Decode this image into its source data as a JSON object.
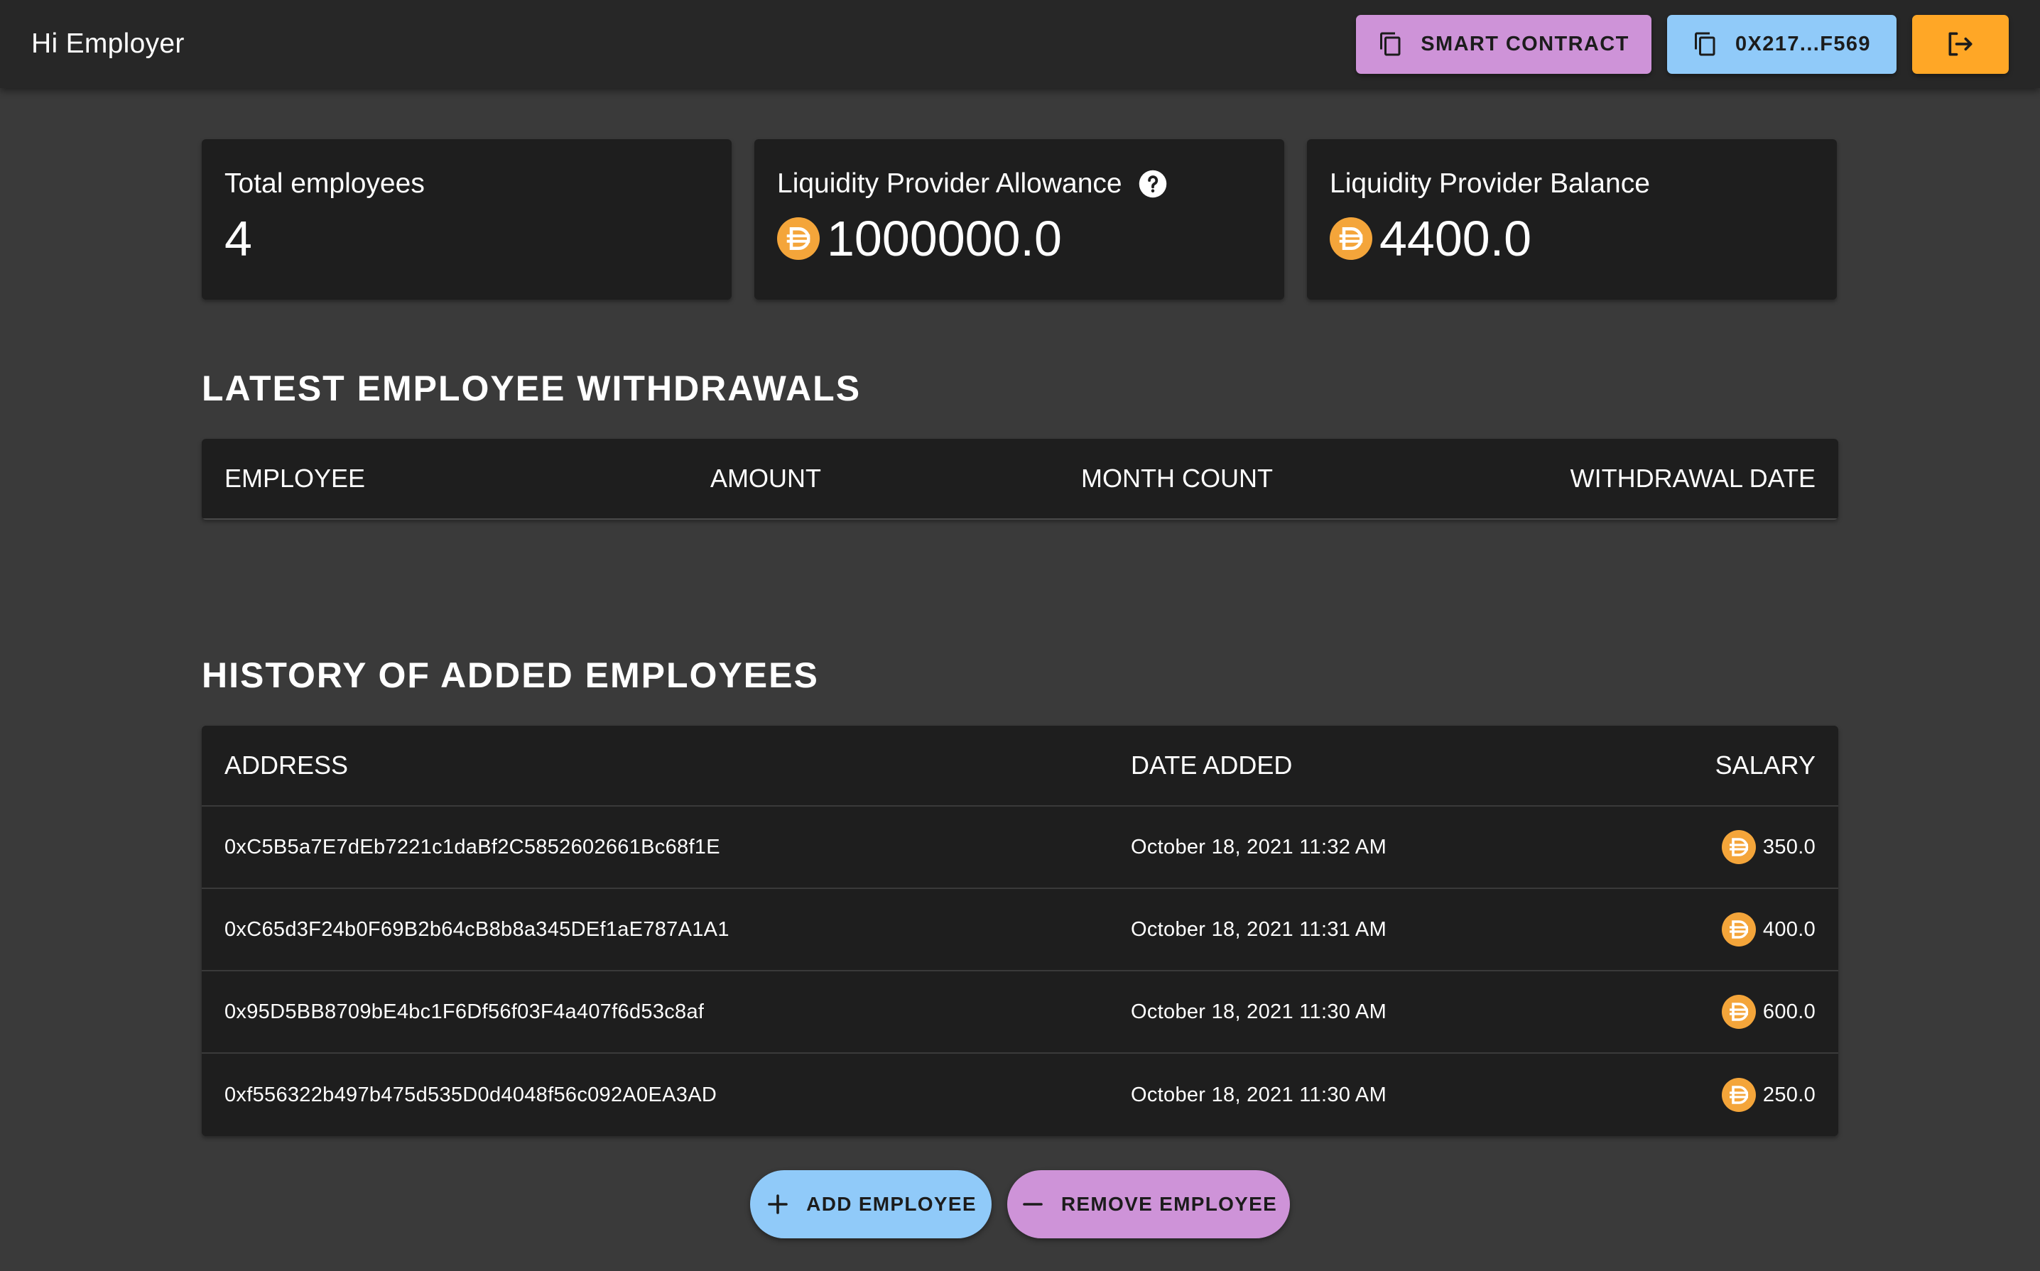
{
  "header": {
    "greeting": "Hi Employer",
    "smart_contract_label": "SMART CONTRACT",
    "wallet_label": "0X217...F569",
    "logout_icon": "logout-icon"
  },
  "stats": {
    "total_employees_label": "Total employees",
    "total_employees_value": "4",
    "allowance_label": "Liquidity Provider Allowance",
    "allowance_value": "1000000.0",
    "balance_label": "Liquidity Provider Balance",
    "balance_value": "4400.0"
  },
  "withdrawals": {
    "title": "LATEST EMPLOYEE WITHDRAWALS",
    "columns": [
      "EMPLOYEE",
      "AMOUNT",
      "MONTH COUNT",
      "WITHDRAWAL DATE"
    ],
    "rows": []
  },
  "history": {
    "title": "HISTORY OF ADDED EMPLOYEES",
    "columns": [
      "ADDRESS",
      "DATE ADDED",
      "SALARY"
    ],
    "rows": [
      {
        "address": "0xC5B5a7E7dEb7221c1daBf2C5852602661Bc68f1E",
        "date": "October 18, 2021 11:32 AM",
        "salary": "350.0"
      },
      {
        "address": "0xC65d3F24b0F69B2b64cB8b8a345DEf1aE787A1A1",
        "date": "October 18, 2021 11:31 AM",
        "salary": "400.0"
      },
      {
        "address": "0x95D5BB8709bE4bc1F6Df56f03F4a407f6d53c8af",
        "date": "October 18, 2021 11:30 AM",
        "salary": "600.0"
      },
      {
        "address": "0xf556322b497b475d535D0d4048f56c092A0EA3AD",
        "date": "October 18, 2021 11:30 AM",
        "salary": "250.0"
      }
    ]
  },
  "actions": {
    "add_label": "ADD EMPLOYEE",
    "remove_label": "REMOVE EMPLOYEE"
  },
  "colors": {
    "background": "#3a3a3a",
    "surface": "#1e1e1e",
    "appbar": "#272727",
    "purple": "#ce93d8",
    "blue": "#90caf9",
    "orange": "#ffa726",
    "coin": "#f4a53a"
  }
}
